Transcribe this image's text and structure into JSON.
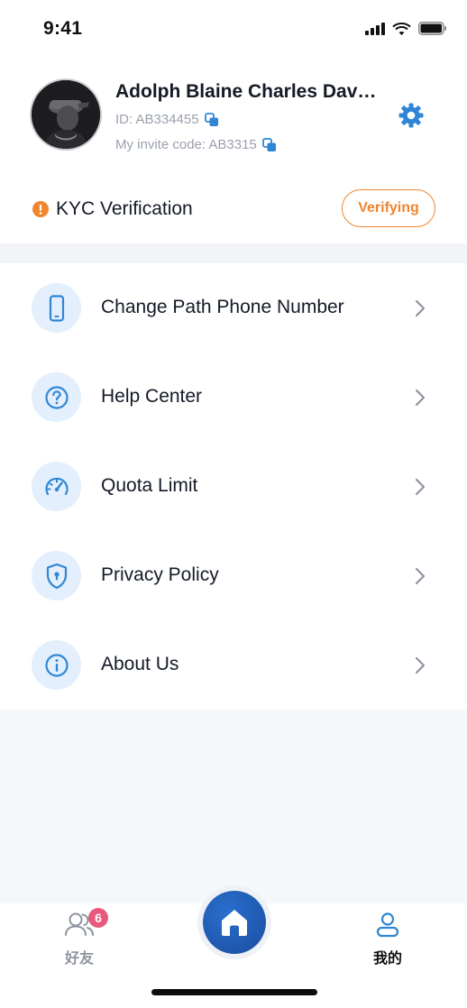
{
  "status_bar": {
    "time": "9:41"
  },
  "profile": {
    "name": "Adolph Blaine Charles Dav…",
    "id_text": "ID: AB334455",
    "invite_text": "My invite code: AB3315"
  },
  "kyc": {
    "label": "KYC Verification",
    "status": "Verifying"
  },
  "menu": {
    "items": [
      {
        "label": "Change Path Phone Number",
        "icon": "phone-icon"
      },
      {
        "label": "Help Center",
        "icon": "help-icon"
      },
      {
        "label": "Quota Limit",
        "icon": "speedometer-icon"
      },
      {
        "label": "Privacy Policy",
        "icon": "shield-icon"
      },
      {
        "label": "About Us",
        "icon": "info-icon"
      }
    ]
  },
  "tabbar": {
    "friends_label": "好友",
    "friends_badge": "6",
    "me_label": "我的"
  },
  "colors": {
    "accent": "#2f86d6",
    "kyc_orange": "#f0852d",
    "badge_pink": "#e85a7d",
    "icon_bg": "#e3effc",
    "home_blue": "#1a4d9c"
  }
}
